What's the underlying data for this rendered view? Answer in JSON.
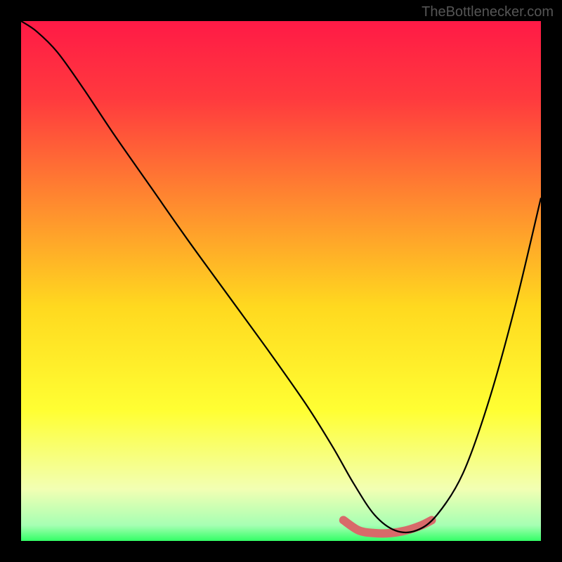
{
  "watermark": "TheBottlenecker.com",
  "chart_data": {
    "type": "line",
    "title": "",
    "xlabel": "",
    "ylabel": "",
    "xlim": [
      0,
      100
    ],
    "ylim": [
      0,
      100
    ],
    "gradient_stops": [
      {
        "offset": 0,
        "color": "#ff1a46"
      },
      {
        "offset": 0.15,
        "color": "#ff3a3e"
      },
      {
        "offset": 0.35,
        "color": "#ff8a2f"
      },
      {
        "offset": 0.55,
        "color": "#ffd91f"
      },
      {
        "offset": 0.75,
        "color": "#ffff33"
      },
      {
        "offset": 0.9,
        "color": "#f2ffb3"
      },
      {
        "offset": 0.97,
        "color": "#a6ffb3"
      },
      {
        "offset": 1.0,
        "color": "#33ff66"
      }
    ],
    "series": [
      {
        "name": "bottleneck-curve",
        "color": "#000000",
        "stroke_width": 2.2,
        "x": [
          0,
          3,
          7,
          12,
          18,
          25,
          32,
          40,
          48,
          55,
          60,
          64,
          68,
          72,
          76,
          80,
          85,
          90,
          95,
          100
        ],
        "y": [
          100,
          98,
          94,
          87,
          78,
          68,
          58,
          47,
          36,
          26,
          18,
          11,
          5,
          2,
          2,
          5,
          13,
          27,
          45,
          66
        ]
      }
    ],
    "highlight": {
      "name": "trough-highlight",
      "color": "#d86a6a",
      "stroke_width": 12,
      "linecap": "round",
      "x": [
        62,
        65,
        68,
        71,
        74,
        77,
        79
      ],
      "y": [
        4,
        2,
        1.5,
        1.5,
        2,
        3,
        4
      ]
    }
  }
}
